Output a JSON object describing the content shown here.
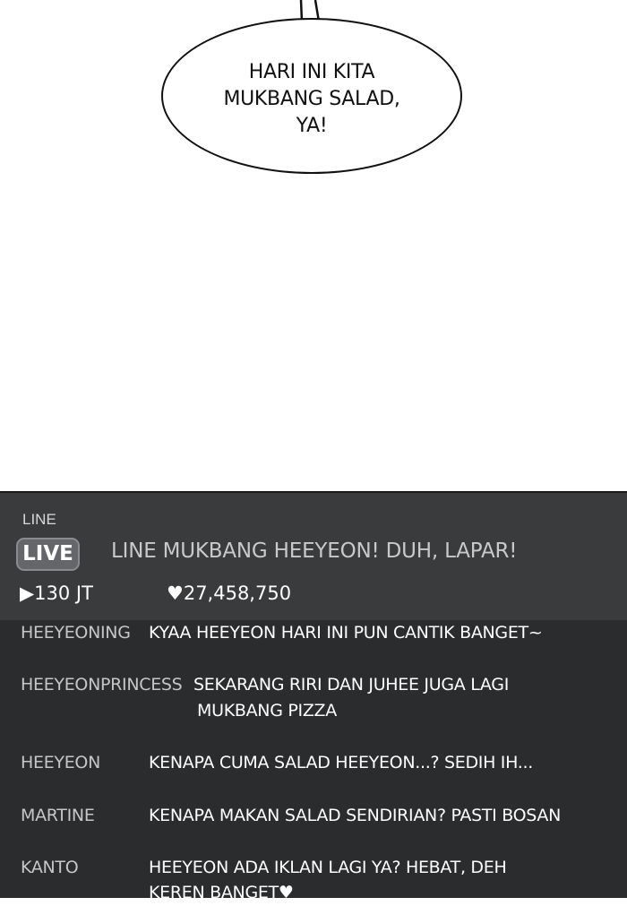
{
  "speech_bubble": {
    "lines": [
      "HARI INI KITA",
      "MUKBANG SALAD,",
      "YA!"
    ]
  },
  "stream": {
    "brand": "LINE",
    "live_badge": "LIVE",
    "title": "LINE  MUKBANG HEEYEON! DUH, LAPAR!",
    "views": "130 JT",
    "likes": "27,458,750",
    "icons": {
      "views": "play-icon",
      "likes": "heart-icon"
    },
    "colors": {
      "panel_bg": "#2b2c2e",
      "header_bg": "#3a3b3d",
      "badge_bg": "#65666a"
    }
  },
  "chat": [
    {
      "user": "HEEYEONING",
      "message": [
        "KYAA HEEYEON HARI INI PUN CANTIK BANGET~"
      ]
    },
    {
      "user": "HEEYEONPRINCESS",
      "message": [
        "SEKARANG RIRI DAN JUHEE JUGA LAGI",
        "MUKBANG PIZZA"
      ]
    },
    {
      "user": "HEEYEON",
      "message": [
        "KENAPA CUMA SALAD HEEYEON...? SEDIH IH..."
      ]
    },
    {
      "user": "MARTINE",
      "message": [
        "KENAPA MAKAN SALAD SENDIRIAN? PASTI BOSAN"
      ]
    },
    {
      "user": "KANTO",
      "message": [
        "HEEYEON ADA IKLAN LAGI YA? HEBAT, DEH",
        "KEREN BANGET♥"
      ]
    }
  ]
}
